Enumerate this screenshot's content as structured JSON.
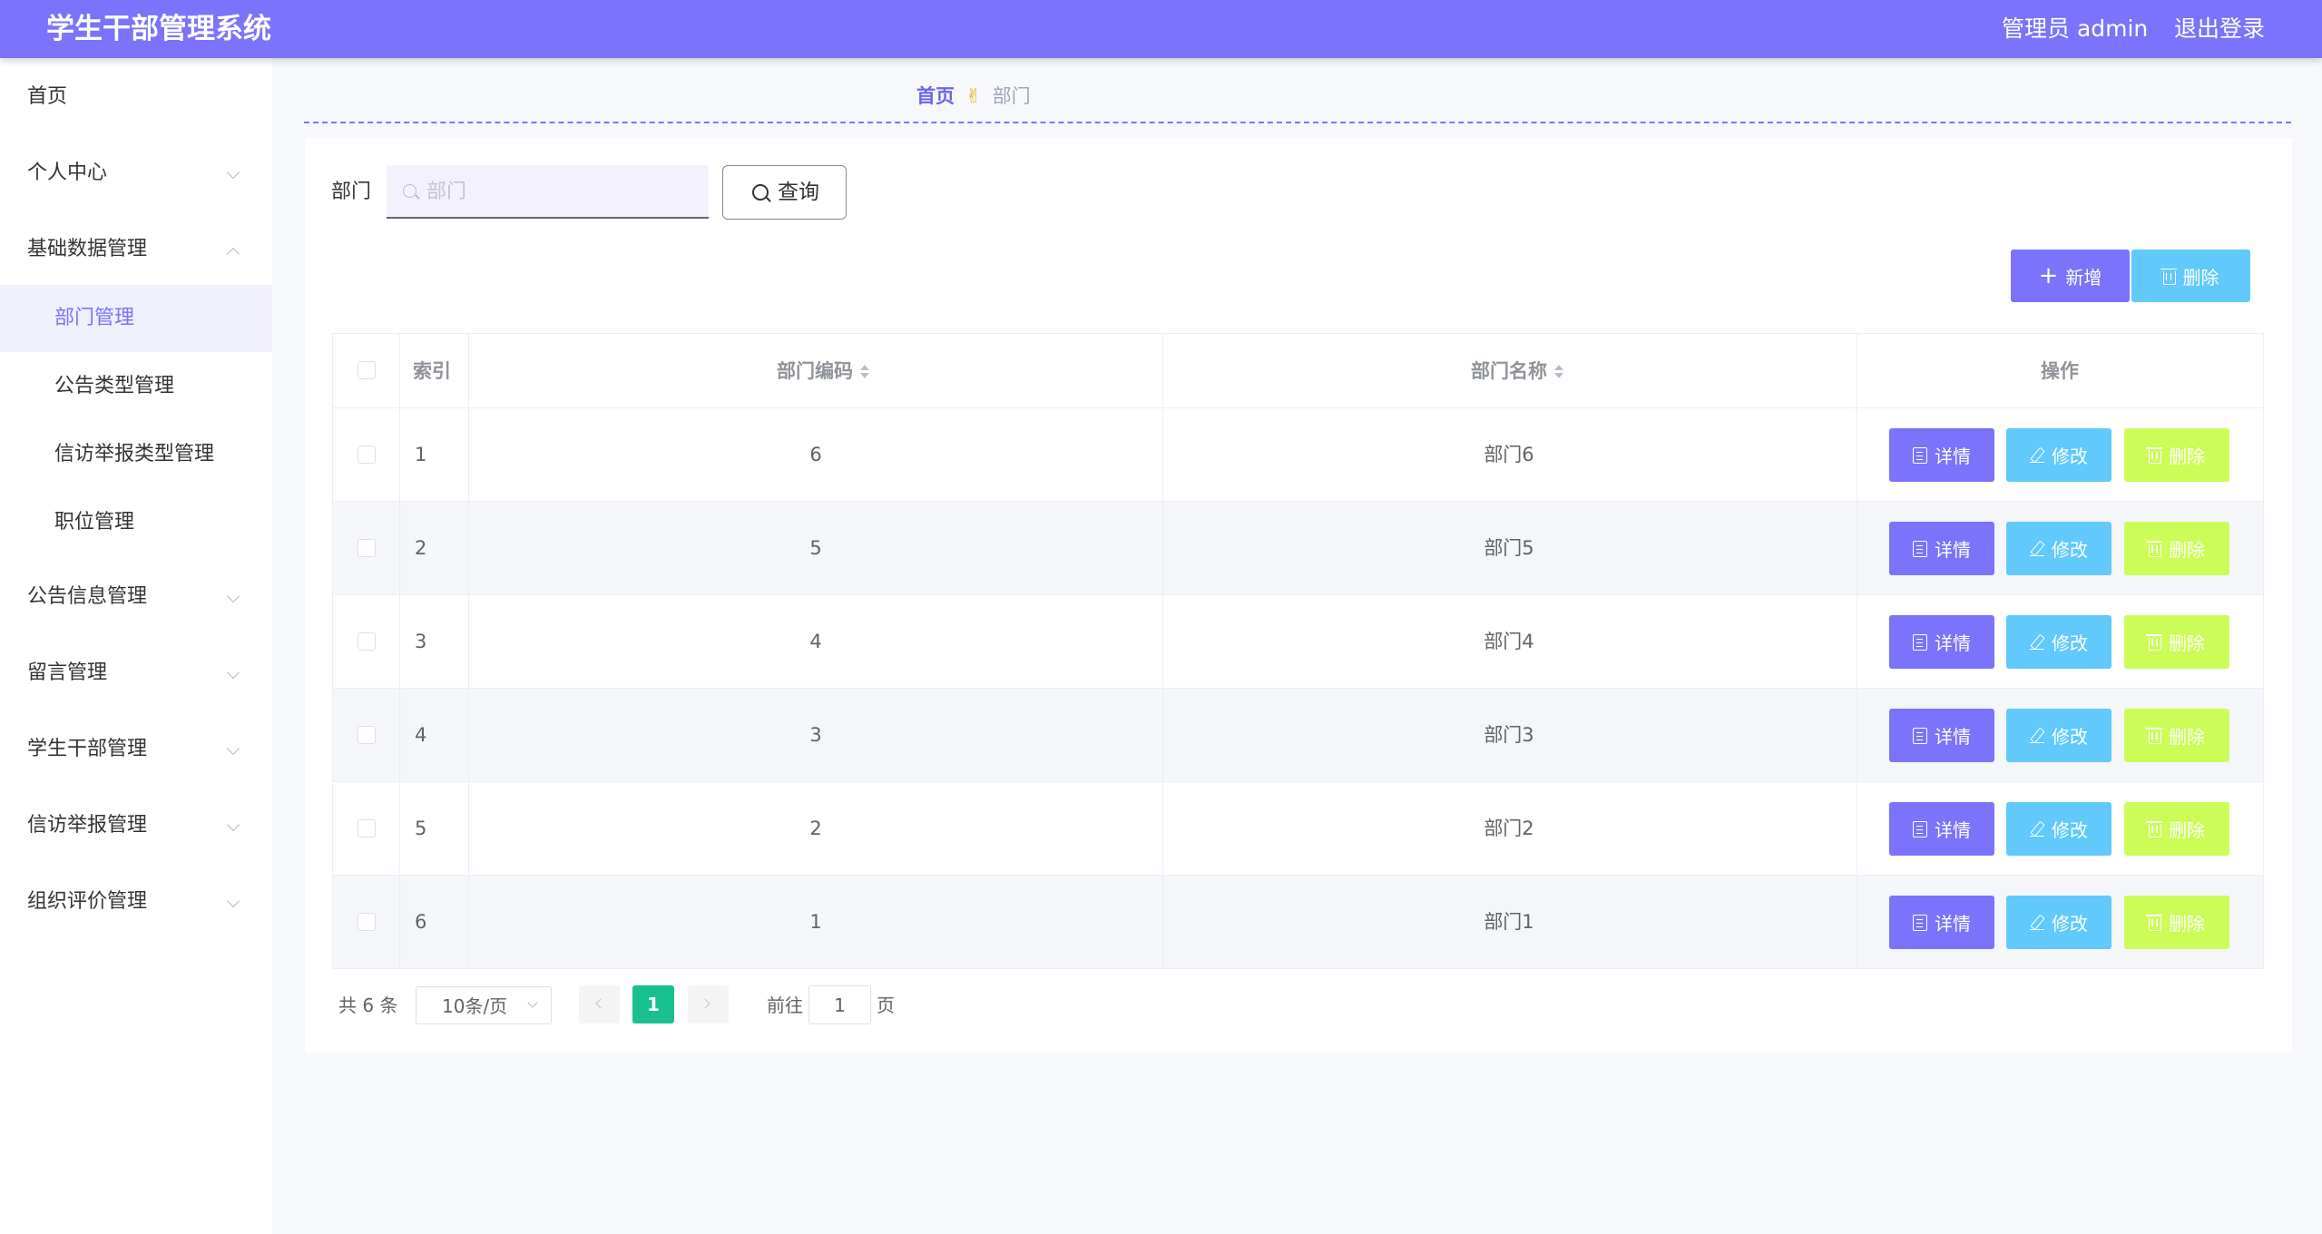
{
  "header": {
    "title": "学生干部管理系统",
    "user": "管理员 admin",
    "logout": "退出登录"
  },
  "sidebar": {
    "home": "首页",
    "personal": "个人中心",
    "basic": "基础数据管理",
    "basic_sub": [
      "部门管理",
      "公告类型管理",
      "信访举报类型管理",
      "职位管理"
    ],
    "notice": "公告信息管理",
    "message": "留言管理",
    "cadre": "学生干部管理",
    "petition": "信访举报管理",
    "evaluation": "组织评价管理"
  },
  "breadcrumb": {
    "home": "首页",
    "sep": "✌",
    "current": "部门"
  },
  "search": {
    "label": "部门",
    "placeholder": "部门",
    "button": "查询"
  },
  "toolbar": {
    "add": "新增",
    "delete": "删除"
  },
  "table": {
    "headers": {
      "index": "索引",
      "code": "部门编码",
      "name": "部门名称",
      "ops": "操作"
    },
    "rows": [
      {
        "index": "1",
        "code": "6",
        "name": "部门6"
      },
      {
        "index": "2",
        "code": "5",
        "name": "部门5"
      },
      {
        "index": "3",
        "code": "4",
        "name": "部门4"
      },
      {
        "index": "4",
        "code": "3",
        "name": "部门3"
      },
      {
        "index": "5",
        "code": "2",
        "name": "部门2"
      },
      {
        "index": "6",
        "code": "1",
        "name": "部门1"
      }
    ],
    "actions": {
      "detail": "详情",
      "edit": "修改",
      "delete": "删除"
    }
  },
  "pagination": {
    "total": "共 6 条",
    "page_size": "10条/页",
    "current": "1",
    "goto": "前往",
    "goto_value": "1",
    "page_unit": "页"
  },
  "colors": {
    "primary": "#7b73fb",
    "info": "#61c9fb",
    "warning": "#ccfc57",
    "success": "#18c090"
  }
}
